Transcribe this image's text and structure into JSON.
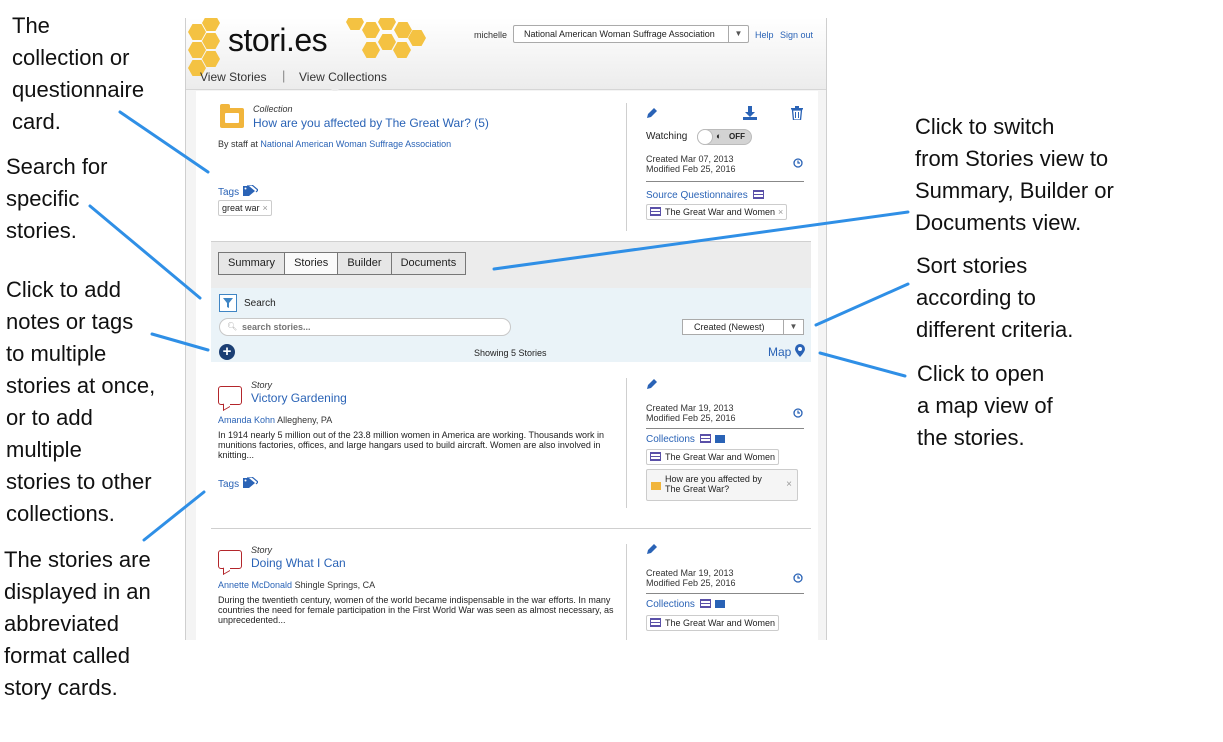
{
  "annotations": {
    "collection_card": [
      "The",
      "collection or",
      "questionnaire",
      "card."
    ],
    "search": [
      "Search for",
      "specific",
      "stories."
    ],
    "add_notes": [
      "Click to add",
      "notes or tags",
      "to multiple",
      "stories at once,",
      "or to add",
      "multiple",
      "stories to other",
      "collections."
    ],
    "story_cards": [
      "The stories are",
      "displayed in an",
      "abbreviated",
      "format called",
      "story cards."
    ],
    "switch_view": [
      "Click to switch",
      "from Stories view to",
      "Summary, Builder or",
      "Documents view."
    ],
    "sort": [
      "Sort stories",
      "according to",
      "different criteria."
    ],
    "map": [
      "Click to open",
      "a map view of",
      "the stories."
    ]
  },
  "header": {
    "logo": "stori.es",
    "user": "michelle",
    "organization": "National American Woman Suffrage Association",
    "help": "Help",
    "sign_out": "Sign out",
    "nav_stories": "View Stories",
    "nav_separator": "|",
    "nav_collections": "View Collections"
  },
  "collection": {
    "type_label": "Collection",
    "title": "How are you affected by The Great War? (5)",
    "by_prefix": "By staff at",
    "org_link": "National American Woman Suffrage Association",
    "tags_label": "Tags",
    "tag": "great war",
    "watching_label": "Watching",
    "toggle_label": "OFF",
    "created": "Created Mar 07, 2013",
    "modified": "Modified Feb 25, 2016",
    "source_label": "Source Questionnaires",
    "source_item": "The Great War and Women"
  },
  "toolbar": {
    "tabs": [
      "Summary",
      "Stories",
      "Builder",
      "Documents"
    ],
    "active_tab": "Stories",
    "search_label": "Search",
    "search_placeholder": "search stories...",
    "sort_value": "Created (Newest)",
    "showing": "Showing 5 Stories",
    "map_label": "Map"
  },
  "stories": [
    {
      "type_label": "Story",
      "title": "Victory Gardening",
      "author": "Amanda Kohn",
      "location": "Allegheny, PA",
      "excerpt": "In 1914 nearly 5 million out of the 23.8 million women in America are working. Thousands work in munitions factories, offices, and large hangars used to build aircraft. Women are also involved in knitting...",
      "tags_label": "Tags",
      "created": "Created Mar 19, 2013",
      "modified": "Modified Feb 25, 2016",
      "collections_label": "Collections",
      "questionnaire": "The Great War and Women",
      "collection_item": "How are you affected by The Great War?"
    },
    {
      "type_label": "Story",
      "title": "Doing What I Can",
      "author": "Annette McDonald",
      "location": "Shingle Springs, CA",
      "excerpt": "During the twentieth century, women of the world became indispensable in the war efforts. In many countries the need for female participation in the First World War was seen as almost necessary, as unprecedented...",
      "created": "Created Mar 19, 2013",
      "modified": "Modified Feb 25, 2016",
      "collections_label": "Collections",
      "questionnaire": "The Great War and Women"
    }
  ],
  "colors": {
    "link": "#2a63b6",
    "leader_line": "#2f8fe6",
    "honeycomb": "#f4c242",
    "story_icon": "#b3262b",
    "folder": "#f1b53c"
  }
}
